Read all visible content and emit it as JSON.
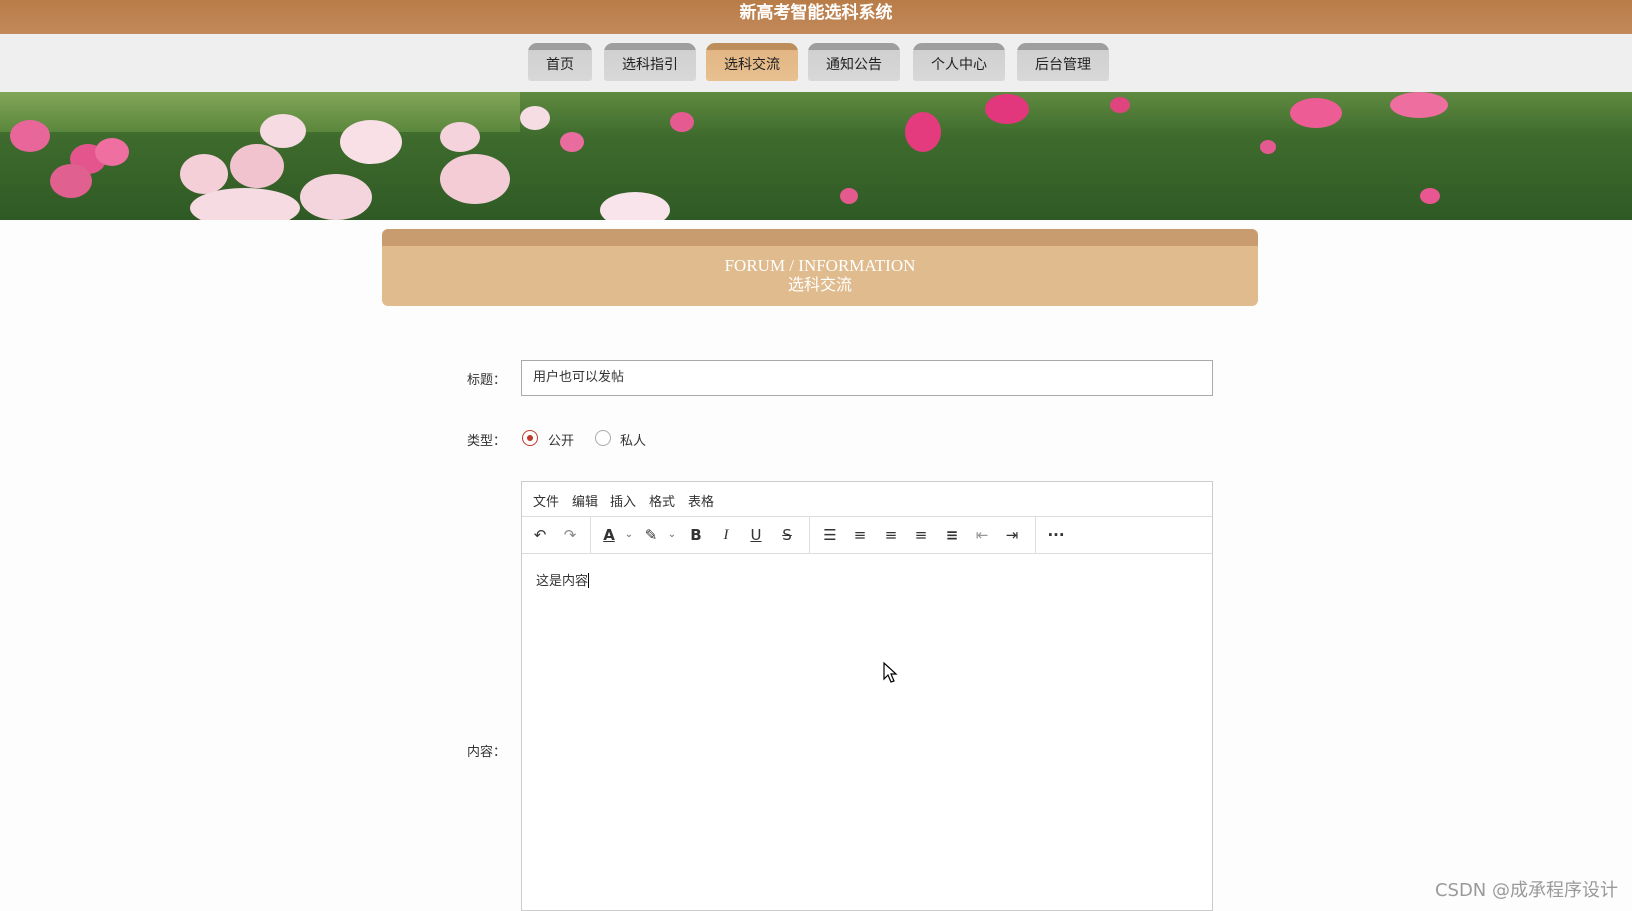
{
  "app": {
    "title": "新高考智能选科系统"
  },
  "nav": {
    "items": [
      {
        "label": "首页"
      },
      {
        "label": "选科指引"
      },
      {
        "label": "选科交流"
      },
      {
        "label": "通知公告"
      },
      {
        "label": "个人中心"
      },
      {
        "label": "后台管理"
      }
    ],
    "active_index": 2
  },
  "section_header": {
    "en": "FORUM / INFORMATION",
    "cn": "选科交流"
  },
  "form": {
    "title_label": "标题：",
    "title_value": "用户也可以发帖",
    "type_label": "类型：",
    "type_options": [
      {
        "label": "公开",
        "checked": true
      },
      {
        "label": "私人",
        "checked": false
      }
    ],
    "content_label": "内容："
  },
  "editor": {
    "menu": [
      "文件",
      "编辑",
      "插入",
      "格式",
      "表格"
    ],
    "toolbar_icons": [
      "undo-icon",
      "redo-icon",
      "text-color-icon",
      "highlight-icon",
      "bold-icon",
      "italic-icon",
      "underline-icon",
      "strikethrough-icon",
      "line-height-icon",
      "align-left-icon",
      "align-center-icon",
      "align-right-icon",
      "align-justify-icon",
      "outdent-icon",
      "indent-icon",
      "more-icon"
    ],
    "content": "这是内容"
  },
  "watermark": "CSDN @成承程序设计",
  "colors": {
    "topbar": "#b87c47",
    "active_tab": "#e2b684",
    "header_box": "#dfbb8e",
    "radio_accent": "#c0392b"
  }
}
